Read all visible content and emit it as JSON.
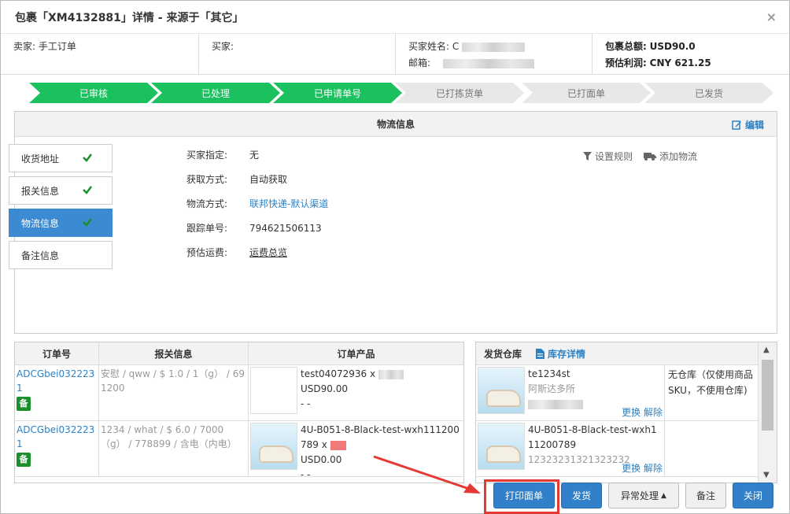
{
  "modal": {
    "title": "包裹「XM4132881」详情 - 来源于「其它」",
    "close": "×"
  },
  "info": {
    "seller_label": "卖家:",
    "seller_value": "手工订单",
    "buyer_label": "买家:",
    "buyer_name_label": "买家姓名:",
    "buyer_name_prefix": "C",
    "email_label": "邮箱:",
    "total_label": "包裹总额:",
    "total_value": "USD90.0",
    "profit_label": "预估利润:",
    "profit_value": "CNY 621.25"
  },
  "steps": [
    {
      "label": "已审核",
      "done": true
    },
    {
      "label": "已处理",
      "done": true
    },
    {
      "label": "已申请单号",
      "done": true
    },
    {
      "label": "已打拣货单",
      "done": false
    },
    {
      "label": "已打面单",
      "done": false
    },
    {
      "label": "已发货",
      "done": false
    }
  ],
  "logistics": {
    "title": "物流信息",
    "edit": "编辑",
    "fields": [
      {
        "label": "买家指定:",
        "value": "无"
      },
      {
        "label": "获取方式:",
        "value": "自动获取"
      },
      {
        "label": "物流方式:",
        "value": "联邦快递-默认渠道"
      },
      {
        "label": "跟踪单号:",
        "value": "794621506113"
      },
      {
        "label": "预估运费:",
        "value": "运费总览"
      }
    ],
    "set_rule": "设置规则",
    "add_logistics": "添加物流"
  },
  "side_tabs": [
    "收货地址",
    "报关信息",
    "物流信息",
    "备注信息"
  ],
  "orders": {
    "headers": [
      "订单号",
      "报关信息",
      "订单产品"
    ],
    "rows": [
      {
        "order_no": "ADCGbei0322231",
        "badge": "备",
        "customs": "安慰 / qww / $ 1.0 / 1（g） / 691200",
        "sku": "test04072936 x",
        "price": "USD90.00",
        "extra": "- -"
      },
      {
        "order_no": "ADCGbei0322231",
        "badge": "备",
        "customs": "1234 / what / $ 6.0 / 7000（g） / 778899 / 含电（内电）",
        "sku": "4U-B051-8-Black-test-wxh111200789 x",
        "price": "USD0.00",
        "extra": "- -"
      }
    ]
  },
  "warehouse": {
    "title": "发货仓库",
    "stock_link": "库存详情",
    "rows": [
      {
        "sku": "te1234st",
        "sub": "阿斯达多所",
        "links": "更换 解除",
        "note": "无仓库（仅使用商品SKU，不使用仓库)"
      },
      {
        "sku": "4U-B051-8-Black-test-wxh111200789",
        "sub": "12323231321323232",
        "links": "更换 解除",
        "note": ""
      }
    ]
  },
  "buttons": {
    "print": "打印面单",
    "ship": "发货",
    "exception": "异常处理",
    "remark": "备注",
    "close": "关闭"
  },
  "colors": {
    "step_done": "#1bc15e",
    "primary": "#3180c9",
    "link": "#2d82c4",
    "highlight": "#e53935"
  }
}
